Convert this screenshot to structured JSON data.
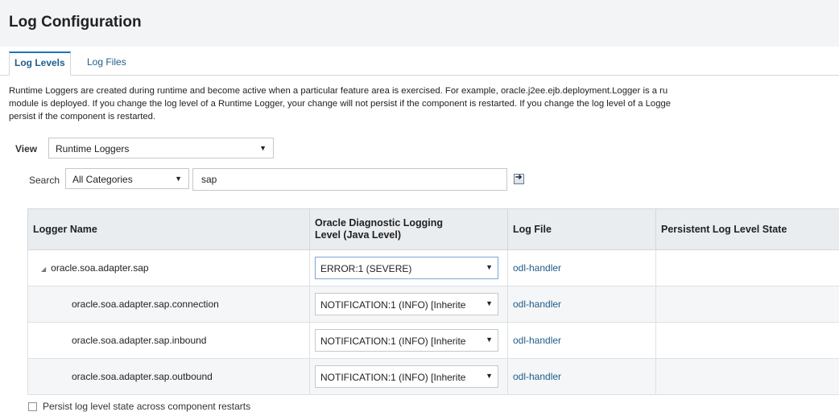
{
  "page": {
    "title": "Log Configuration"
  },
  "tabs": [
    {
      "label": "Log Levels",
      "active": true
    },
    {
      "label": "Log Files",
      "active": false
    }
  ],
  "description": {
    "line1": "Runtime Loggers are created during runtime and become active when a particular feature area is exercised. For example, oracle.j2ee.ejb.deployment.Logger is a ru",
    "line2": "module is deployed. If you change the log level of a Runtime Logger, your change will not persist if the component is restarted. If you change the log level of a Logge",
    "line3": "persist if the component is restarted."
  },
  "view": {
    "label": "View",
    "selected": "Runtime Loggers"
  },
  "search": {
    "label": "Search",
    "category": "All Categories",
    "query": "sap"
  },
  "table": {
    "headers": {
      "logger_name": "Logger Name",
      "odl_level_line1": "Oracle Diagnostic Logging",
      "odl_level_line2": "Level (Java Level)",
      "log_file": "Log File",
      "persistent_state": "Persistent Log Level State"
    },
    "rows": [
      {
        "name": "oracle.soa.adapter.sap",
        "level": "ERROR:1 (SEVERE)",
        "log_file": "odl-handler",
        "persistent_state": ""
      },
      {
        "name": "oracle.soa.adapter.sap.connection",
        "level": "NOTIFICATION:1 (INFO) [Inherite",
        "log_file": "odl-handler",
        "persistent_state": ""
      },
      {
        "name": "oracle.soa.adapter.sap.inbound",
        "level": "NOTIFICATION:1 (INFO) [Inherite",
        "log_file": "odl-handler",
        "persistent_state": ""
      },
      {
        "name": "oracle.soa.adapter.sap.outbound",
        "level": "NOTIFICATION:1 (INFO) [Inherite",
        "log_file": "odl-handler",
        "persistent_state": ""
      }
    ]
  },
  "footer": {
    "persist_label": "Persist log level state across component restarts",
    "persist_checked": false
  },
  "icons": {
    "dropdown": "dropdown-arrow-icon",
    "go": "go-arrow-icon",
    "tree_expanded": "tree-expanded-icon"
  }
}
